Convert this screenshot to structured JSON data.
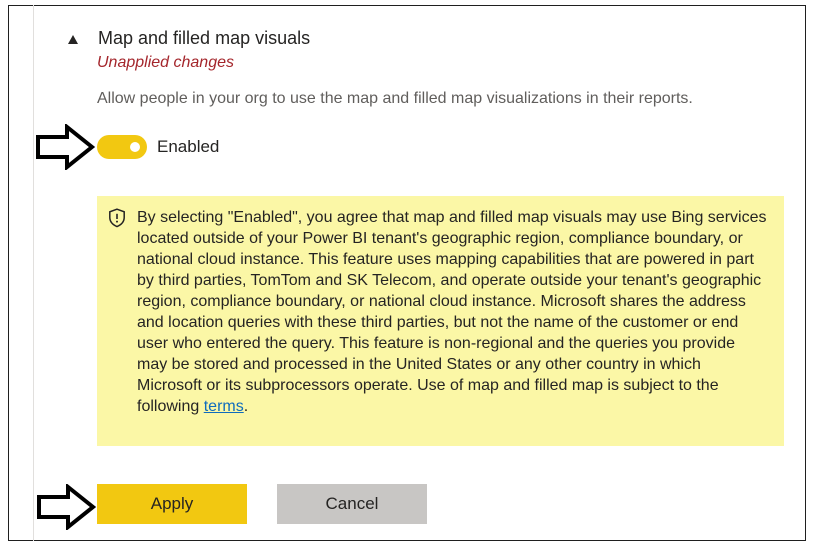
{
  "setting": {
    "title": "Map and filled map visuals",
    "status": "Unapplied changes",
    "description": "Allow people in your org to use the map and filled map visualizations in their reports.",
    "toggle": {
      "state": "on",
      "label": "Enabled"
    }
  },
  "notice": {
    "text": "By selecting \"Enabled\", you agree that map and filled map visuals may use Bing services located outside of your Power BI tenant's geographic region, compliance boundary, or national cloud instance. This feature uses mapping capabilities that are powered in part by third parties, TomTom and SK Telecom, and operate outside your tenant's geographic region, compliance boundary, or national cloud instance. Microsoft shares the address and location queries with these third parties, but not the name of the customer or end user who entered the query. This feature is non-regional and the queries you provide may be stored and processed in the United States or any other country in which Microsoft or its subprocessors operate. Use of map and filled map is subject to the following",
    "link_text": "terms",
    "suffix": "."
  },
  "actions": {
    "apply_label": "Apply",
    "cancel_label": "Cancel"
  },
  "colors": {
    "accent": "#f2c811",
    "notice_bg": "#fbf7a6",
    "status": "#a4262c",
    "link": "#0f6cbd"
  },
  "icons": {
    "collapse": "caret-up-icon",
    "notice": "shield-icon",
    "pointer": "arrow-right-icon"
  }
}
